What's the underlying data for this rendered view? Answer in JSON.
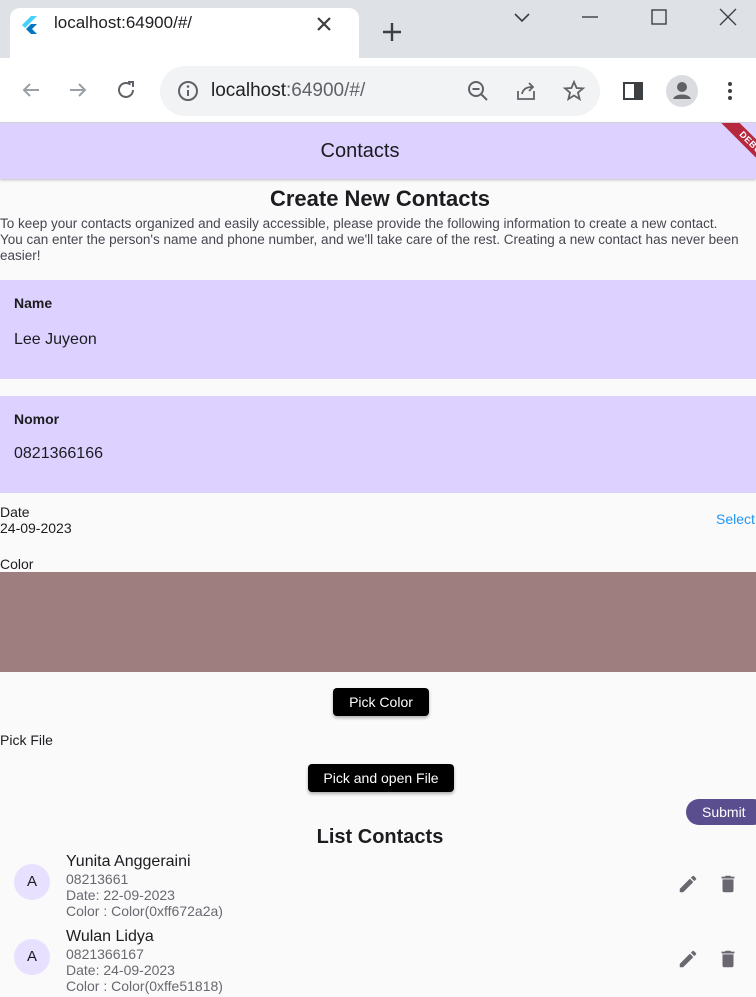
{
  "browser": {
    "tab_title": "localhost:64900/#/",
    "url_host": "localhost",
    "url_rest": ":64900/#/"
  },
  "appbar": {
    "title": "Contacts",
    "debug_label": "DEBUG"
  },
  "form": {
    "heading": "Create New Contacts",
    "description_lines": [
      "To keep your contacts organized and easily accessible, please provide the following information to create a new contact.",
      "You can enter the person's name and phone number, and we'll take care of the rest. Creating a new contact has never been",
      "easier!"
    ],
    "name_label": "Name",
    "name_value": "Lee Juyeon",
    "number_label": "Nomor",
    "number_value": "0821366166",
    "date_label": "Date",
    "date_value": "24-09-2023",
    "select_label": "Select",
    "color_label": "Color",
    "color_value": "#9e7e7e",
    "pick_color_label": "Pick Color",
    "pick_file_label": "Pick File",
    "pick_open_file_label": "Pick and open File",
    "submit_label": "Submit"
  },
  "list": {
    "heading": "List Contacts",
    "contacts": [
      {
        "initial": "A",
        "name": "Yunita Anggeraini",
        "number": "08213661",
        "date": "Date: 22-09-2023",
        "color": "Color : Color(0xff672a2a)"
      },
      {
        "initial": "A",
        "name": "Wulan Lidya",
        "number": "0821366167",
        "date": "Date: 24-09-2023",
        "color": "Color : Color(0xffe51818)"
      }
    ]
  },
  "colors": {
    "accent": "#dcd1ff",
    "submit": "#5b4e8e",
    "link": "#2196f3"
  }
}
